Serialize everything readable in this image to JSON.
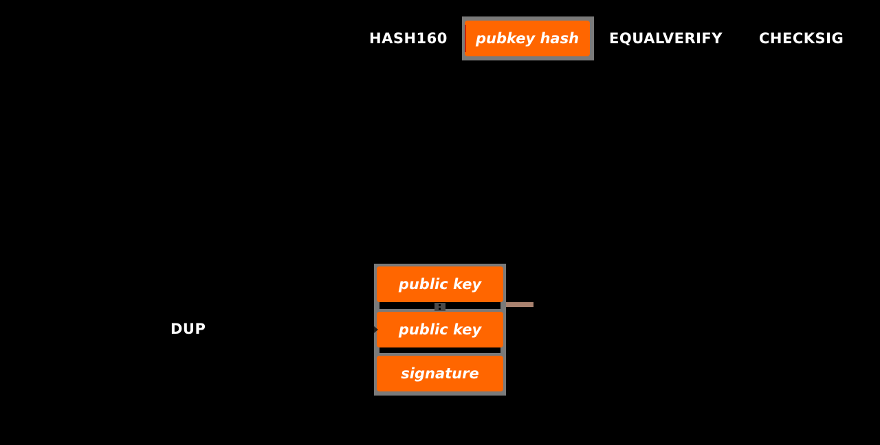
{
  "script_ops": {
    "hash160": "HASH160",
    "pubkey_hash": "pubkey hash",
    "equalverify": "EQUALVERIFY",
    "checksig": "CHECKSIG"
  },
  "current_op": {
    "dup": "DUP"
  },
  "stack": {
    "items": [
      "public key",
      "public key",
      "signature"
    ]
  },
  "colors": {
    "chip": "#ff6600",
    "frame": "#7a7a7a",
    "connector": "#a9826f",
    "background": "#000000"
  }
}
